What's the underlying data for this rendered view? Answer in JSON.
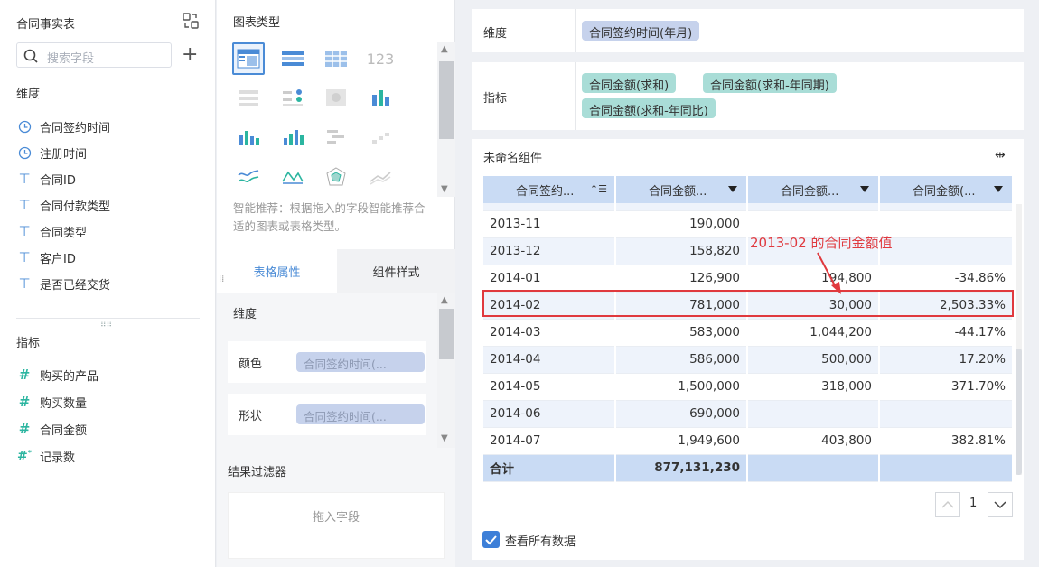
{
  "left_panel": {
    "title": "合同事实表",
    "search_placeholder": "搜索字段",
    "dimensions_label": "维度",
    "dimensions": [
      {
        "icon": "clock-icon",
        "label": "合同签约时间"
      },
      {
        "icon": "clock-icon",
        "label": "注册时间"
      },
      {
        "icon": "text-icon",
        "label": "合同ID"
      },
      {
        "icon": "text-icon",
        "label": "合同付款类型"
      },
      {
        "icon": "text-icon",
        "label": "合同类型"
      },
      {
        "icon": "text-icon",
        "label": "客户ID"
      },
      {
        "icon": "text-icon",
        "label": "是否已经交货"
      }
    ],
    "measures_label": "指标",
    "measures": [
      {
        "icon": "hash-icon",
        "label": "购买的产品"
      },
      {
        "icon": "hash-icon",
        "label": "购买数量"
      },
      {
        "icon": "hash-icon",
        "label": "合同金额"
      },
      {
        "icon": "hash-star-icon",
        "label": "记录数"
      }
    ]
  },
  "middle_panel": {
    "chart_type_title": "图表类型",
    "hint": "智能推荐：根据拖入的字段智能推荐合适的图表或表格类型。",
    "tabs": [
      "表格属性",
      "组件样式"
    ],
    "active_tab": "表格属性",
    "dimension_label": "维度",
    "props": [
      {
        "label": "颜色",
        "value": "合同签约时间(..."
      },
      {
        "label": "形状",
        "value": "合同签约时间(..."
      }
    ],
    "filter_title": "结果过滤器",
    "filter_drop": "拖入字段"
  },
  "config": {
    "dimension_label": "维度",
    "dimension_chip": "合同签约时间(年月)",
    "measure_label": "指标",
    "measure_chips": [
      "合同金额(求和)",
      "合同金额(求和-年同期)",
      "合同金额(求和-年同比)"
    ]
  },
  "widget": {
    "title": "未命名组件",
    "columns": [
      "合同签约...",
      "合同金额...",
      "合同金额...",
      "合同金额(..."
    ],
    "rows": [
      [
        "2013-11",
        "190,000",
        "",
        ""
      ],
      [
        "2013-12",
        "158,820",
        "",
        ""
      ],
      [
        "2014-01",
        "126,900",
        "194,800",
        "-34.86%"
      ],
      [
        "2014-02",
        "781,000",
        "30,000",
        "2,503.33%"
      ],
      [
        "2014-03",
        "583,000",
        "1,044,200",
        "-44.17%"
      ],
      [
        "2014-04",
        "586,000",
        "500,000",
        "17.20%"
      ],
      [
        "2014-05",
        "1,500,000",
        "318,000",
        "371.70%"
      ],
      [
        "2014-06",
        "690,000",
        "",
        ""
      ],
      [
        "2014-07",
        "1,949,600",
        "403,800",
        "382.81%"
      ]
    ],
    "total_label": "合计",
    "total_value": "877,131,230",
    "annotation": "2013-02 的合同金额值",
    "page": "1",
    "show_all_label": "查看所有数据",
    "accent_color": "#3d7fd8",
    "highlight_color": "#e0393e"
  }
}
